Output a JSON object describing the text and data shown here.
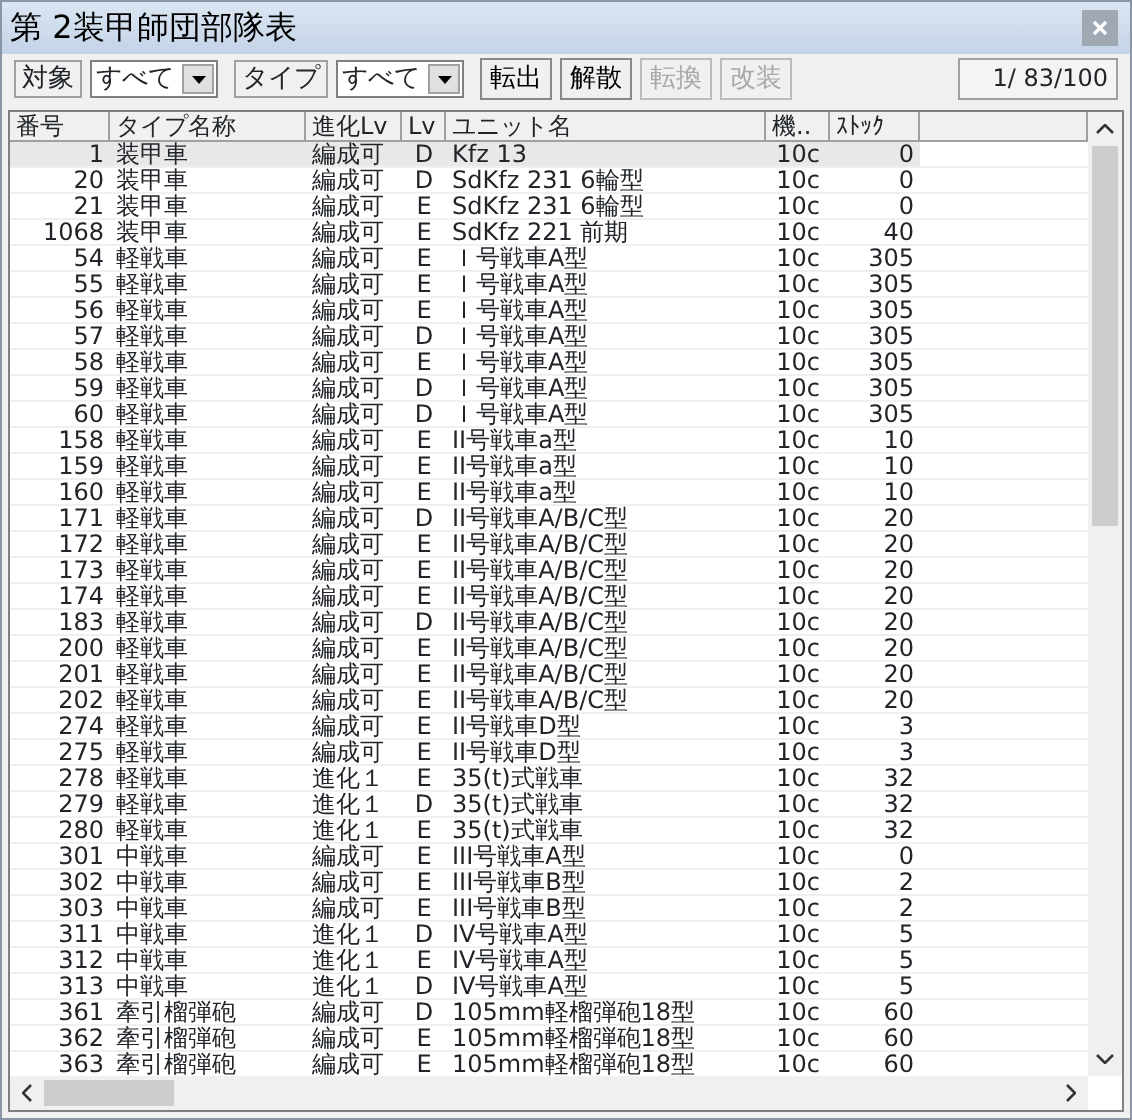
{
  "window": {
    "title": "第 2装甲師団部隊表"
  },
  "toolbar": {
    "filters": [
      {
        "label": "対象",
        "value": "すべて"
      },
      {
        "label": "タイプ",
        "value": "すべて"
      }
    ],
    "buttons": [
      {
        "label": "転出",
        "disabled": false
      },
      {
        "label": "解散",
        "disabled": false
      },
      {
        "label": "転換",
        "disabled": true
      },
      {
        "label": "改装",
        "disabled": true
      }
    ],
    "counter": "1/ 83/100"
  },
  "table": {
    "columns": [
      "番号",
      "タイプ名称",
      "進化Lv",
      "Lv",
      "ユニット名",
      "機..",
      "ｽﾄｯｸ"
    ],
    "rows": [
      {
        "cells": [
          "1",
          "装甲車",
          "編成可",
          "D",
          "Kfz 13",
          "10c",
          "0"
        ],
        "selected": true
      },
      {
        "cells": [
          "20",
          "装甲車",
          "編成可",
          "D",
          "SdKfz 231 6輪型",
          "10c",
          "0"
        ],
        "selected": false
      },
      {
        "cells": [
          "21",
          "装甲車",
          "編成可",
          "E",
          "SdKfz 231 6輪型",
          "10c",
          "0"
        ],
        "selected": false
      },
      {
        "cells": [
          "1068",
          "装甲車",
          "編成可",
          "E",
          "SdKfz 221 前期",
          "10c",
          "40"
        ],
        "selected": false
      },
      {
        "cells": [
          "54",
          "軽戦車",
          "編成可",
          "E",
          "Ｉ号戦車A型",
          "10c",
          "305"
        ],
        "selected": false
      },
      {
        "cells": [
          "55",
          "軽戦車",
          "編成可",
          "E",
          "Ｉ号戦車A型",
          "10c",
          "305"
        ],
        "selected": false
      },
      {
        "cells": [
          "56",
          "軽戦車",
          "編成可",
          "E",
          "Ｉ号戦車A型",
          "10c",
          "305"
        ],
        "selected": false
      },
      {
        "cells": [
          "57",
          "軽戦車",
          "編成可",
          "D",
          "Ｉ号戦車A型",
          "10c",
          "305"
        ],
        "selected": false
      },
      {
        "cells": [
          "58",
          "軽戦車",
          "編成可",
          "E",
          "Ｉ号戦車A型",
          "10c",
          "305"
        ],
        "selected": false
      },
      {
        "cells": [
          "59",
          "軽戦車",
          "編成可",
          "D",
          "Ｉ号戦車A型",
          "10c",
          "305"
        ],
        "selected": false
      },
      {
        "cells": [
          "60",
          "軽戦車",
          "編成可",
          "D",
          "Ｉ号戦車A型",
          "10c",
          "305"
        ],
        "selected": false
      },
      {
        "cells": [
          "158",
          "軽戦車",
          "編成可",
          "E",
          "II号戦車a型",
          "10c",
          "10"
        ],
        "selected": false
      },
      {
        "cells": [
          "159",
          "軽戦車",
          "編成可",
          "E",
          "II号戦車a型",
          "10c",
          "10"
        ],
        "selected": false
      },
      {
        "cells": [
          "160",
          "軽戦車",
          "編成可",
          "E",
          "II号戦車a型",
          "10c",
          "10"
        ],
        "selected": false
      },
      {
        "cells": [
          "171",
          "軽戦車",
          "編成可",
          "D",
          "II号戦車A/B/C型",
          "10c",
          "20"
        ],
        "selected": false
      },
      {
        "cells": [
          "172",
          "軽戦車",
          "編成可",
          "E",
          "II号戦車A/B/C型",
          "10c",
          "20"
        ],
        "selected": false
      },
      {
        "cells": [
          "173",
          "軽戦車",
          "編成可",
          "E",
          "II号戦車A/B/C型",
          "10c",
          "20"
        ],
        "selected": false
      },
      {
        "cells": [
          "174",
          "軽戦車",
          "編成可",
          "E",
          "II号戦車A/B/C型",
          "10c",
          "20"
        ],
        "selected": false
      },
      {
        "cells": [
          "183",
          "軽戦車",
          "編成可",
          "D",
          "II号戦車A/B/C型",
          "10c",
          "20"
        ],
        "selected": false
      },
      {
        "cells": [
          "200",
          "軽戦車",
          "編成可",
          "E",
          "II号戦車A/B/C型",
          "10c",
          "20"
        ],
        "selected": false
      },
      {
        "cells": [
          "201",
          "軽戦車",
          "編成可",
          "E",
          "II号戦車A/B/C型",
          "10c",
          "20"
        ],
        "selected": false
      },
      {
        "cells": [
          "202",
          "軽戦車",
          "編成可",
          "E",
          "II号戦車A/B/C型",
          "10c",
          "20"
        ],
        "selected": false
      },
      {
        "cells": [
          "274",
          "軽戦車",
          "編成可",
          "E",
          "II号戦車D型",
          "10c",
          "3"
        ],
        "selected": false
      },
      {
        "cells": [
          "275",
          "軽戦車",
          "編成可",
          "E",
          "II号戦車D型",
          "10c",
          "3"
        ],
        "selected": false
      },
      {
        "cells": [
          "278",
          "軽戦車",
          "進化１",
          "E",
          "35(t)式戦車",
          "10c",
          "32"
        ],
        "selected": false
      },
      {
        "cells": [
          "279",
          "軽戦車",
          "進化１",
          "D",
          "35(t)式戦車",
          "10c",
          "32"
        ],
        "selected": false
      },
      {
        "cells": [
          "280",
          "軽戦車",
          "進化１",
          "E",
          "35(t)式戦車",
          "10c",
          "32"
        ],
        "selected": false
      },
      {
        "cells": [
          "301",
          "中戦車",
          "編成可",
          "E",
          "III号戦車A型",
          "10c",
          "0"
        ],
        "selected": false
      },
      {
        "cells": [
          "302",
          "中戦車",
          "編成可",
          "E",
          "III号戦車B型",
          "10c",
          "2"
        ],
        "selected": false
      },
      {
        "cells": [
          "303",
          "中戦車",
          "編成可",
          "E",
          "III号戦車B型",
          "10c",
          "2"
        ],
        "selected": false
      },
      {
        "cells": [
          "311",
          "中戦車",
          "進化１",
          "D",
          "IV号戦車A型",
          "10c",
          "5"
        ],
        "selected": false
      },
      {
        "cells": [
          "312",
          "中戦車",
          "進化１",
          "E",
          "IV号戦車A型",
          "10c",
          "5"
        ],
        "selected": false
      },
      {
        "cells": [
          "313",
          "中戦車",
          "進化１",
          "D",
          "IV号戦車A型",
          "10c",
          "5"
        ],
        "selected": false
      },
      {
        "cells": [
          "361",
          "牽引榴弾砲",
          "編成可",
          "D",
          "105mm軽榴弾砲18型",
          "10c",
          "60"
        ],
        "selected": false
      },
      {
        "cells": [
          "362",
          "牽引榴弾砲",
          "編成可",
          "E",
          "105mm軽榴弾砲18型",
          "10c",
          "60"
        ],
        "selected": false
      },
      {
        "cells": [
          "363",
          "牽引榴弾砲",
          "編成可",
          "E",
          "105mm軽榴弾砲18型",
          "10c",
          "60"
        ],
        "selected": false
      }
    ]
  }
}
